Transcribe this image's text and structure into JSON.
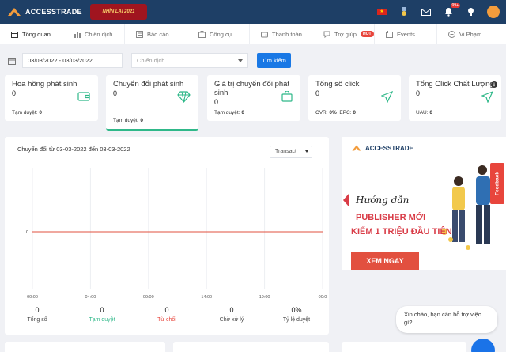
{
  "brand": {
    "name": "ACCESSTRADE",
    "promo": "NHÌN LẠI 2021",
    "flag": "★"
  },
  "topbar": {
    "notifications_badge": "99+"
  },
  "nav": [
    {
      "label": "Tổng quan",
      "icon": "calendar-icon"
    },
    {
      "label": "Chiến dịch",
      "icon": "bar-chart-icon"
    },
    {
      "label": "Báo cáo",
      "icon": "report-icon"
    },
    {
      "label": "Công cụ",
      "icon": "tool-icon"
    },
    {
      "label": "Thanh toán",
      "icon": "wallet-icon"
    },
    {
      "label": "Trợ giúp",
      "icon": "help-icon",
      "badge": "HOT"
    },
    {
      "label": "Events",
      "icon": "events-icon"
    },
    {
      "label": "Vi Phạm",
      "icon": "violation-icon"
    }
  ],
  "filter": {
    "date_range": "03/03/2022 - 03/03/2022",
    "campaign_placeholder": "Chiến dịch",
    "search_label": "Tìm kiếm"
  },
  "cards": [
    {
      "title": "Hoa hồng phát sinh",
      "value": "0",
      "sub_label": "Tạm duyệt:",
      "sub_value": "0",
      "icon": "wallet-icon"
    },
    {
      "title": "Chuyển đổi phát sinh",
      "value": "0",
      "sub_label": "Tạm duyệt:",
      "sub_value": "0",
      "icon": "diamond-icon"
    },
    {
      "title": "Giá trị chuyển đổi phát sinh",
      "value": "0",
      "sub_label": "Tạm duyệt:",
      "sub_value": "0",
      "icon": "shopping-bag-icon"
    },
    {
      "title": "Tổng số click",
      "value": "0",
      "sub_label": "CVR:",
      "sub_value": "0%",
      "sub_label2": "EPC:",
      "sub_value2": "0",
      "icon": "send-icon"
    },
    {
      "title": "Tổng Click Chất Lượng",
      "value": "0",
      "sub_label": "UAU:",
      "sub_value": "0",
      "icon": "send-icon"
    }
  ],
  "chart_panel": {
    "title": "Chuyển đổi từ 03-03-2022 đến 03-03-2022",
    "select_value": "Transact"
  },
  "chart_data": {
    "type": "line",
    "x": [
      "00:00",
      "04:00",
      "09:00",
      "14:00",
      "19:00",
      "00:0"
    ],
    "series": [
      {
        "values": [
          0,
          0,
          0,
          0,
          0,
          0
        ],
        "color": "#e2503f"
      }
    ],
    "y_ticks": [
      "0"
    ],
    "grid": true
  },
  "summary": [
    {
      "value": "0",
      "label": "Tổng số",
      "color": "default"
    },
    {
      "value": "0",
      "label": "Tạm duyệt",
      "color": "green"
    },
    {
      "value": "0",
      "label": "Từ chối",
      "color": "red"
    },
    {
      "value": "0",
      "label": "Chờ xử lý",
      "color": "default"
    },
    {
      "value": "0%",
      "label": "Tỷ lệ duyệt",
      "color": "default"
    }
  ],
  "banner": {
    "logo": "ACCESSTRADE",
    "script": "Hướng dẫn",
    "line1": "PUBLISHER MỚI",
    "line2": "KIẾM 1 TRIỆU ĐẦU TIÊN",
    "button": "XEM NGAY"
  },
  "feedback_label": "Feedback",
  "chat": {
    "message": "Xin chào, bạn cần hỗ trợ việc gì?"
  },
  "colors": {
    "topbar": "#1e3f66",
    "accent": "#1978e5",
    "green": "#2fb889",
    "red": "#e8453c"
  }
}
